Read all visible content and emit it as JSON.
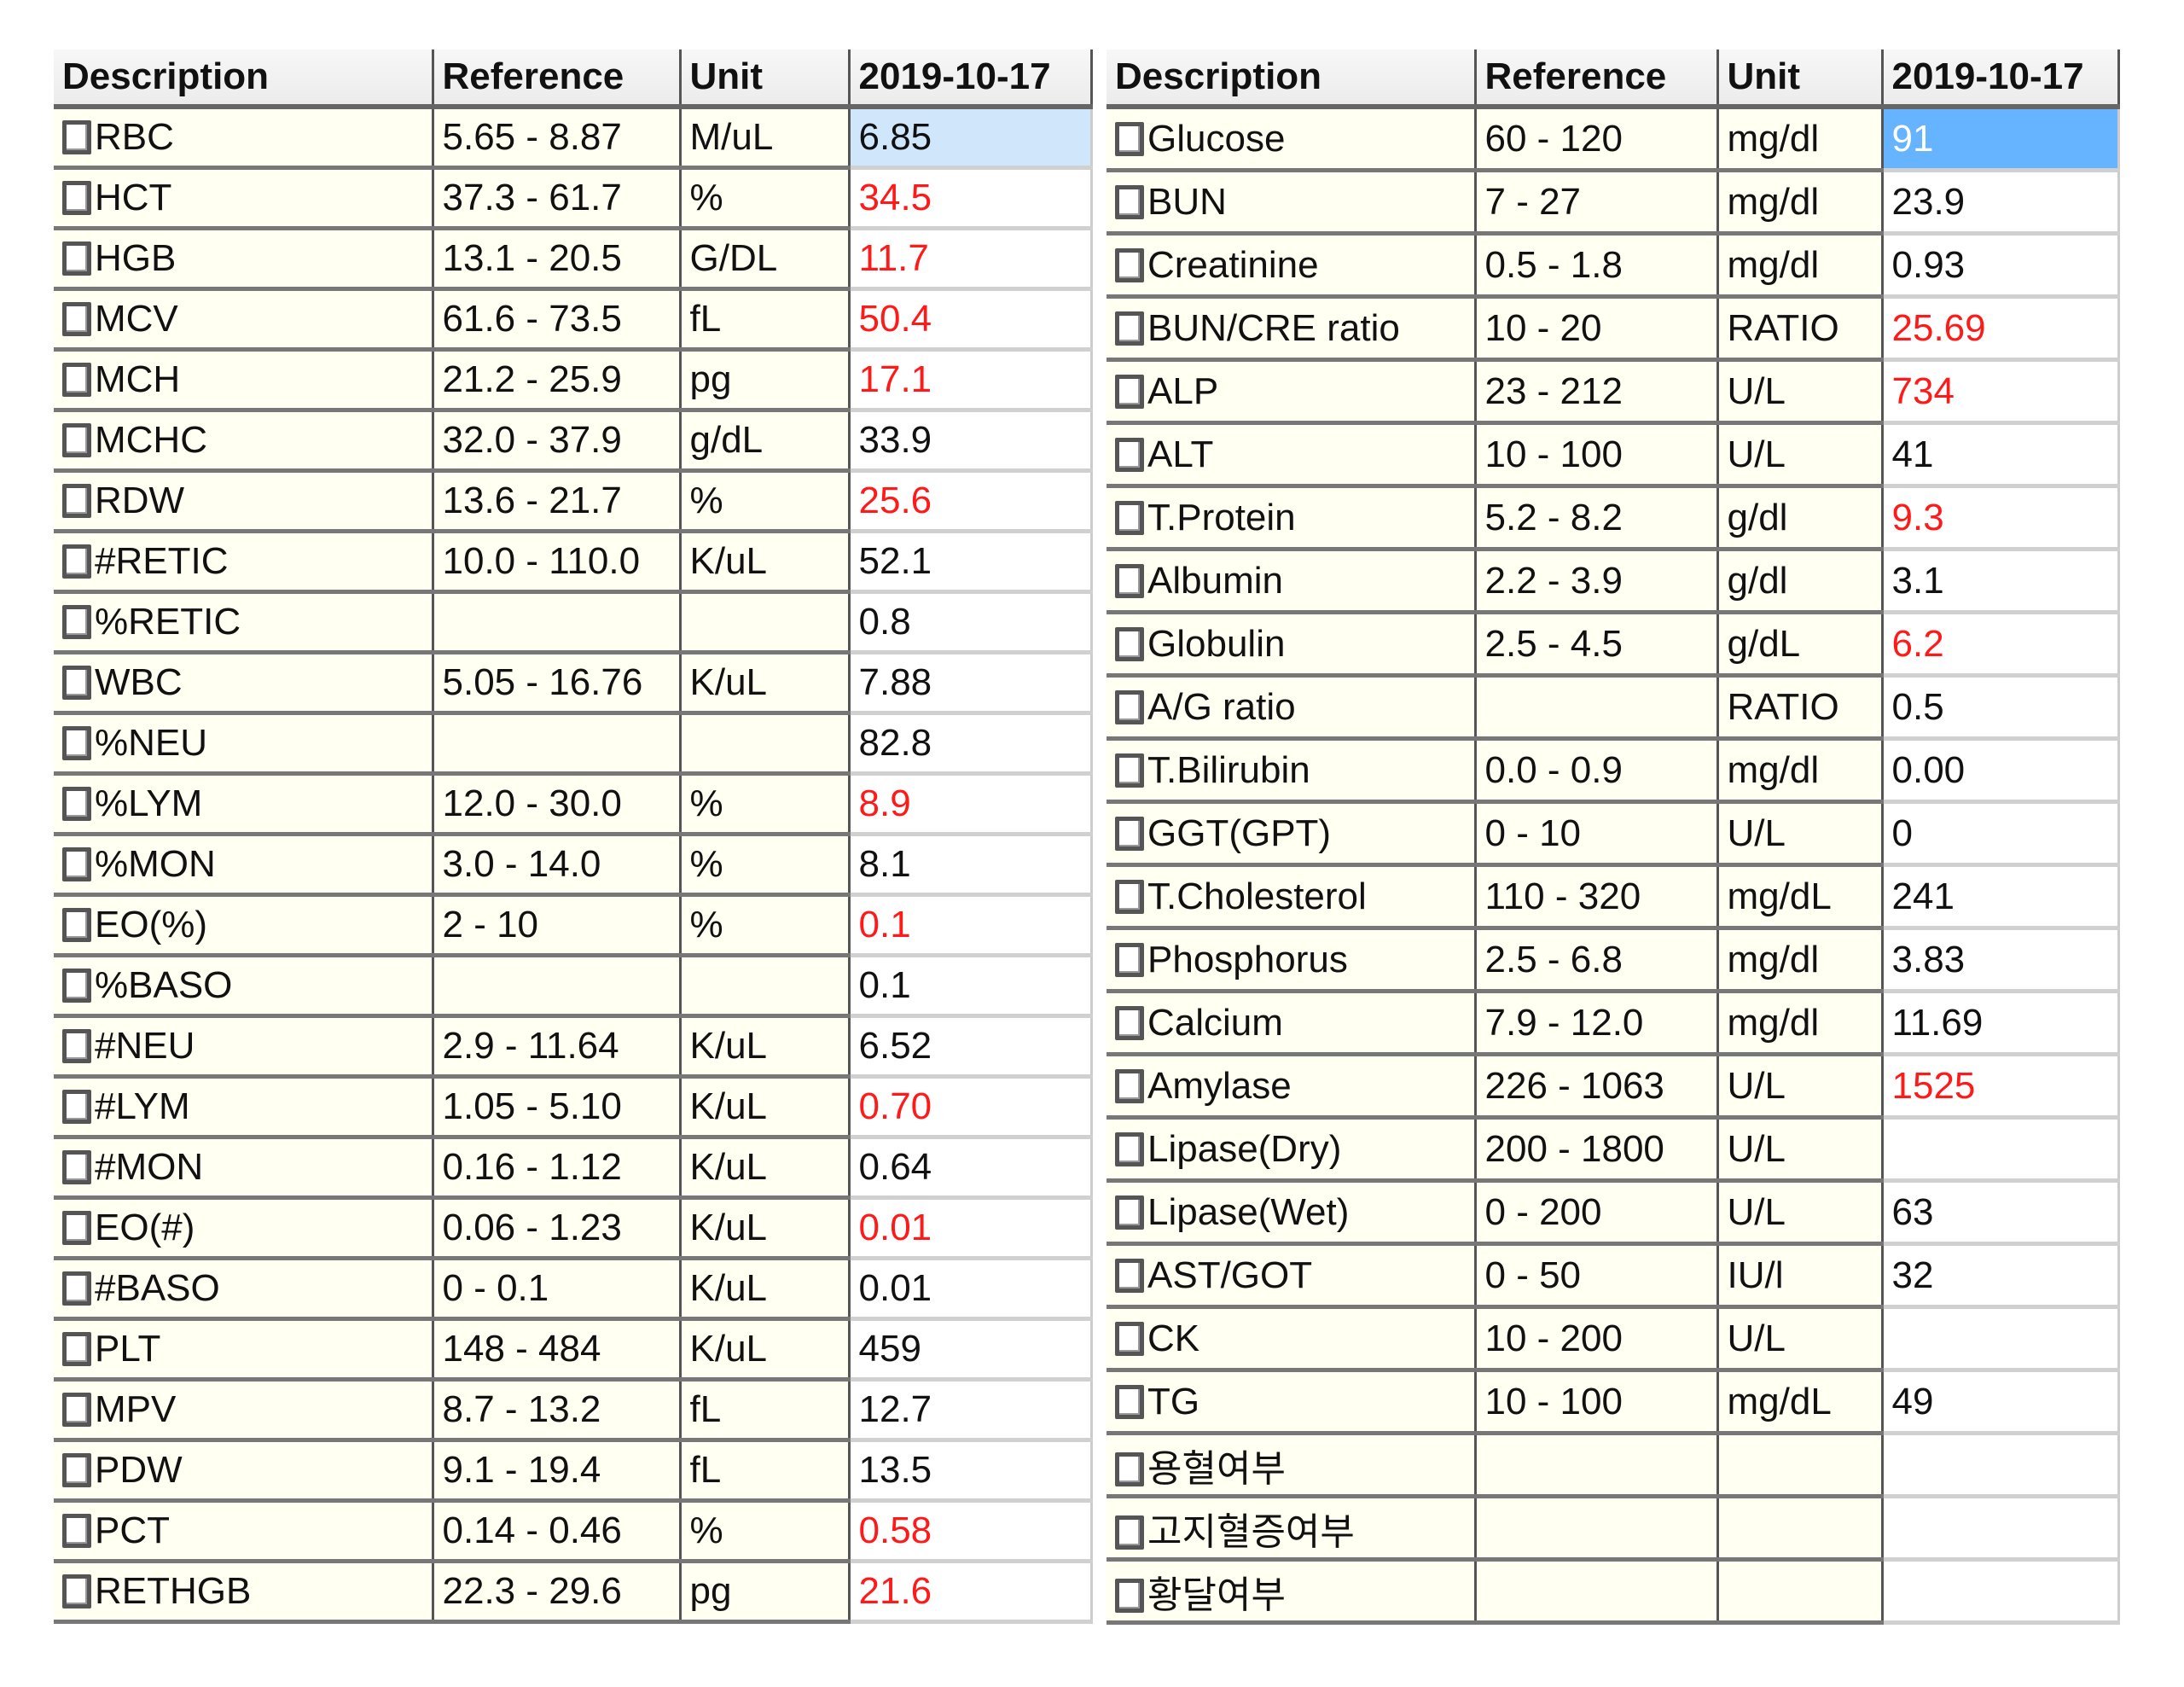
{
  "colors": {
    "abnormal": "#ff1a1a",
    "cell_bg": "#fffff2",
    "selected_light": "#cfe6fb",
    "selected_dark": "#66b3ff"
  },
  "left_table": {
    "headers": [
      "Description",
      "Reference",
      "Unit",
      "2019-10-17"
    ],
    "rows": [
      {
        "desc": "RBC",
        "ref": "5.65 - 8.87",
        "unit": "M/uL",
        "value": "6.85",
        "abnormal": false,
        "selected": "light"
      },
      {
        "desc": "HCT",
        "ref": "37.3 - 61.7",
        "unit": "%",
        "value": "34.5",
        "abnormal": true
      },
      {
        "desc": "HGB",
        "ref": "13.1 - 20.5",
        "unit": "G/DL",
        "value": "11.7",
        "abnormal": true
      },
      {
        "desc": "MCV",
        "ref": "61.6 - 73.5",
        "unit": "fL",
        "value": "50.4",
        "abnormal": true
      },
      {
        "desc": "MCH",
        "ref": "21.2 - 25.9",
        "unit": "pg",
        "value": "17.1",
        "abnormal": true
      },
      {
        "desc": "MCHC",
        "ref": "32.0 - 37.9",
        "unit": "g/dL",
        "value": "33.9",
        "abnormal": false
      },
      {
        "desc": "RDW",
        "ref": "13.6 - 21.7",
        "unit": "%",
        "value": "25.6",
        "abnormal": true
      },
      {
        "desc": "#RETIC",
        "ref": "10.0 - 110.0",
        "unit": "K/uL",
        "value": "52.1",
        "abnormal": false
      },
      {
        "desc": "%RETIC",
        "ref": "",
        "unit": "",
        "value": "0.8",
        "abnormal": false
      },
      {
        "desc": "WBC",
        "ref": "5.05 - 16.76",
        "unit": "K/uL",
        "value": "7.88",
        "abnormal": false
      },
      {
        "desc": "%NEU",
        "ref": "",
        "unit": "",
        "value": "82.8",
        "abnormal": false
      },
      {
        "desc": "%LYM",
        "ref": "12.0 - 30.0",
        "unit": "%",
        "value": "8.9",
        "abnormal": true
      },
      {
        "desc": "%MON",
        "ref": "3.0 - 14.0",
        "unit": "%",
        "value": "8.1",
        "abnormal": false
      },
      {
        "desc": "EO(%)",
        "ref": "2 - 10",
        "unit": "%",
        "value": "0.1",
        "abnormal": true
      },
      {
        "desc": "%BASO",
        "ref": "",
        "unit": "",
        "value": "0.1",
        "abnormal": false
      },
      {
        "desc": "#NEU",
        "ref": "2.9 - 11.64",
        "unit": "K/uL",
        "value": "6.52",
        "abnormal": false
      },
      {
        "desc": "#LYM",
        "ref": "1.05 - 5.10",
        "unit": "K/uL",
        "value": "0.70",
        "abnormal": true
      },
      {
        "desc": "#MON",
        "ref": "0.16 - 1.12",
        "unit": "K/uL",
        "value": "0.64",
        "abnormal": false
      },
      {
        "desc": "EO(#)",
        "ref": "0.06 - 1.23",
        "unit": "K/uL",
        "value": "0.01",
        "abnormal": true
      },
      {
        "desc": "#BASO",
        "ref": "0 - 0.1",
        "unit": "K/uL",
        "value": "0.01",
        "abnormal": false
      },
      {
        "desc": "PLT",
        "ref": "148 - 484",
        "unit": "K/uL",
        "value": "459",
        "abnormal": false
      },
      {
        "desc": "MPV",
        "ref": "8.7 - 13.2",
        "unit": "fL",
        "value": "12.7",
        "abnormal": false
      },
      {
        "desc": "PDW",
        "ref": "9.1 - 19.4",
        "unit": "fL",
        "value": "13.5",
        "abnormal": false
      },
      {
        "desc": "PCT",
        "ref": "0.14 - 0.46",
        "unit": "%",
        "value": "0.58",
        "abnormal": true
      },
      {
        "desc": "RETHGB",
        "ref": "22.3 - 29.6",
        "unit": "pg",
        "value": "21.6",
        "abnormal": true
      }
    ]
  },
  "right_table": {
    "headers": [
      "Description",
      "Reference",
      "Unit",
      "2019-10-17"
    ],
    "rows": [
      {
        "desc": "Glucose",
        "ref": "60 - 120",
        "unit": "mg/dl",
        "value": "91",
        "abnormal": false,
        "selected": "dark"
      },
      {
        "desc": "BUN",
        "ref": "7 - 27",
        "unit": "mg/dl",
        "value": "23.9",
        "abnormal": false
      },
      {
        "desc": "Creatinine",
        "ref": "0.5 - 1.8",
        "unit": "mg/dl",
        "value": "0.93",
        "abnormal": false
      },
      {
        "desc": "BUN/CRE ratio",
        "ref": "10 - 20",
        "unit": "RATIO",
        "value": "25.69",
        "abnormal": true
      },
      {
        "desc": "ALP",
        "ref": "23 - 212",
        "unit": "U/L",
        "value": "734",
        "abnormal": true
      },
      {
        "desc": "ALT",
        "ref": "10 - 100",
        "unit": "U/L",
        "value": "41",
        "abnormal": false
      },
      {
        "desc": "T.Protein",
        "ref": "5.2 - 8.2",
        "unit": "g/dl",
        "value": "9.3",
        "abnormal": true
      },
      {
        "desc": "Albumin",
        "ref": "2.2 - 3.9",
        "unit": "g/dl",
        "value": "3.1",
        "abnormal": false
      },
      {
        "desc": "Globulin",
        "ref": "2.5 - 4.5",
        "unit": "g/dL",
        "value": "6.2",
        "abnormal": true
      },
      {
        "desc": "A/G ratio",
        "ref": "",
        "unit": "RATIO",
        "value": "0.5",
        "abnormal": false
      },
      {
        "desc": "T.Bilirubin",
        "ref": "0.0 - 0.9",
        "unit": "mg/dl",
        "value": "0.00",
        "abnormal": false
      },
      {
        "desc": "GGT(GPT)",
        "ref": "0 - 10",
        "unit": "U/L",
        "value": "0",
        "abnormal": false
      },
      {
        "desc": "T.Cholesterol",
        "ref": "110 - 320",
        "unit": "mg/dL",
        "value": "241",
        "abnormal": false
      },
      {
        "desc": "Phosphorus",
        "ref": "2.5 - 6.8",
        "unit": "mg/dl",
        "value": "3.83",
        "abnormal": false
      },
      {
        "desc": "Calcium",
        "ref": "7.9 - 12.0",
        "unit": "mg/dl",
        "value": "11.69",
        "abnormal": false
      },
      {
        "desc": "Amylase",
        "ref": "226 - 1063",
        "unit": "U/L",
        "value": "1525",
        "abnormal": true
      },
      {
        "desc": "Lipase(Dry)",
        "ref": "200 - 1800",
        "unit": "U/L",
        "value": "",
        "abnormal": false
      },
      {
        "desc": "Lipase(Wet)",
        "ref": "0 - 200",
        "unit": "U/L",
        "value": "63",
        "abnormal": false
      },
      {
        "desc": "AST/GOT",
        "ref": "0 - 50",
        "unit": "IU/l",
        "value": "32",
        "abnormal": false
      },
      {
        "desc": "CK",
        "ref": "10 - 200",
        "unit": "U/L",
        "value": "",
        "abnormal": false
      },
      {
        "desc": "TG",
        "ref": "10 - 100",
        "unit": "mg/dL",
        "value": "49",
        "abnormal": false
      },
      {
        "desc": "용혈여부",
        "ref": "",
        "unit": "",
        "value": "",
        "abnormal": false
      },
      {
        "desc": "고지혈증여부",
        "ref": "",
        "unit": "",
        "value": "",
        "abnormal": false
      },
      {
        "desc": "황달여부",
        "ref": "",
        "unit": "",
        "value": "",
        "abnormal": false
      }
    ]
  }
}
